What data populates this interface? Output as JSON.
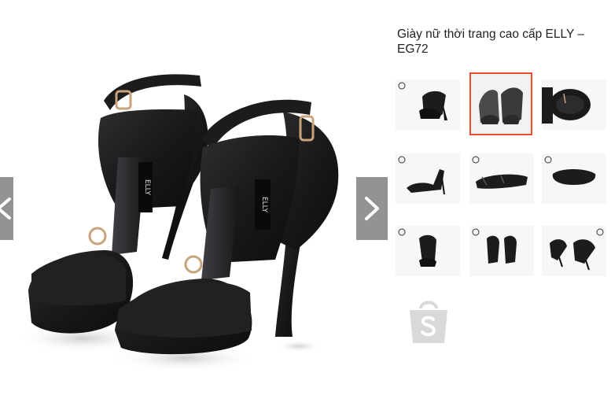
{
  "product": {
    "title": "Giày nữ thời trang cao cấp ELLY – EG72"
  },
  "gallery": {
    "active_index": 1,
    "main_image_alt": "Giày nữ thời trang cao cấp ELLY – EG72",
    "brand_text": "ELLY",
    "thumbnails": [
      {
        "alt": "Giày nữ thời trang cao cấp ELLY – EG72 - ảnh 1"
      },
      {
        "alt": "Giày nữ thời trang cao cấp ELLY – EG72 - ảnh 2"
      },
      {
        "alt": "Giày nữ thời trang cao cấp ELLY – EG72 - ảnh 3"
      },
      {
        "alt": "Giày nữ thời trang cao cấp ELLY – EG72 - ảnh 4"
      },
      {
        "alt": "Giày nữ thời trang cao cấp ELLY – EG72 - ảnh 5"
      },
      {
        "alt": "Giày nữ thời trang cao cấp ELLY – EG72 - ảnh 6"
      },
      {
        "alt": "Giày nữ thời trang cao cấp ELLY – EG72 - ảnh 7"
      },
      {
        "alt": "Giày nữ thời trang cao cấp ELLY – EG72 - ảnh 8"
      },
      {
        "alt": "Giày nữ thời trang cao cấp ELLY – EG72 - ảnh 9"
      }
    ]
  },
  "icons": {
    "prev": "chevron-left-icon",
    "next": "chevron-right-icon",
    "shopee": "shopee-bag-icon"
  },
  "colors": {
    "active_border": "#ee4d2d",
    "arrow_bg": "#8a8a8a",
    "shoe": "#1b1b1d",
    "logo_gray": "#d9d9d9"
  }
}
